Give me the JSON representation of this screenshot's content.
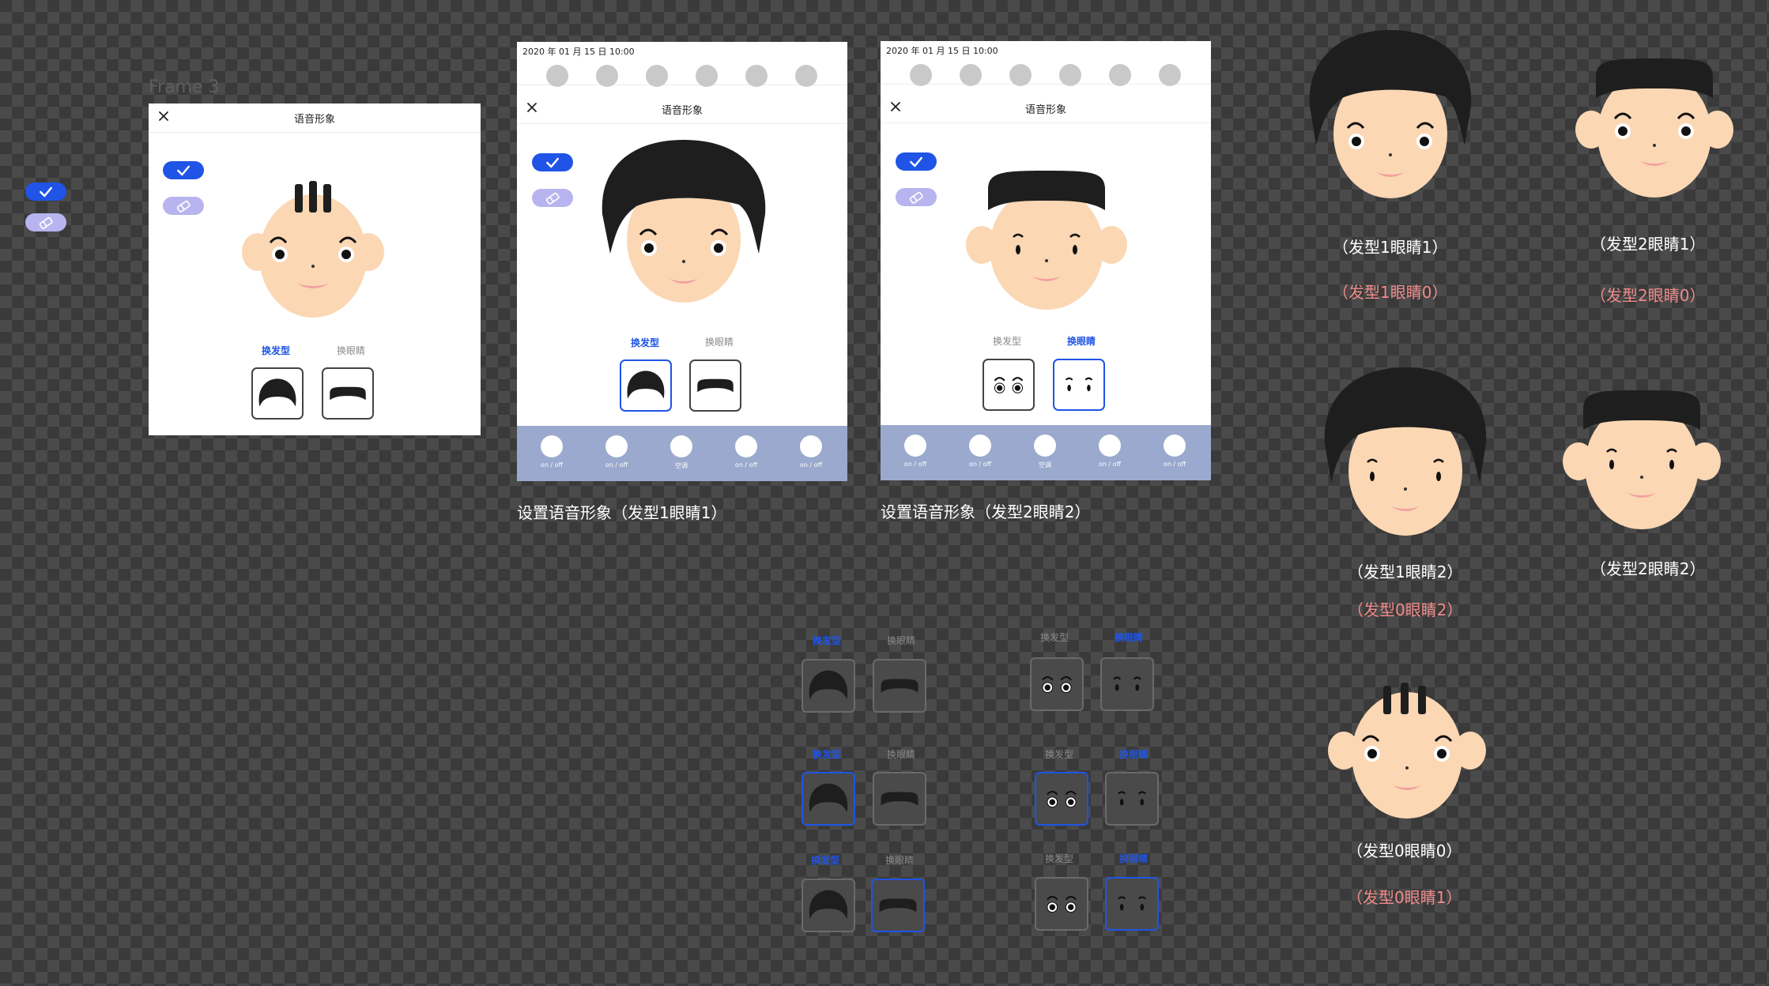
{
  "frame_label": "Frame 3",
  "panel": {
    "status_time": "2020 年 01 月 15 日 10:00",
    "title": "语音形象",
    "tab_hair": "换发型",
    "tab_eyes": "换眼睛",
    "bottom_items": [
      {
        "label": "on / off"
      },
      {
        "label": "on / off"
      },
      {
        "label": "空调"
      },
      {
        "label": "on / off"
      },
      {
        "label": "on / off"
      }
    ]
  },
  "captions": {
    "screen1": "设置语音形象（发型1眼睛1）",
    "screen2": "设置语音形象（发型2眼睛2）"
  },
  "avatars": {
    "a1": {
      "label": "（发型1眼睛1）",
      "sub": "（发型1眼睛0）"
    },
    "a2": {
      "label": "（发型2眼睛1）",
      "sub": "（发型2眼睛0）"
    },
    "a3": {
      "label": "（发型1眼睛2）",
      "sub": "（发型0眼睛2）"
    },
    "a4": {
      "label": "（发型2眼睛2）"
    },
    "a5": {
      "label": "（发型0眼睛0）",
      "sub": "（发型0眼睛1）"
    }
  },
  "colors": {
    "accent": "#1f54e6",
    "skin": "#fbd7b4",
    "hair": "#1e1e1e",
    "caption_pink": "#f08a8a",
    "bottom_bar": "#9aa9cd"
  }
}
